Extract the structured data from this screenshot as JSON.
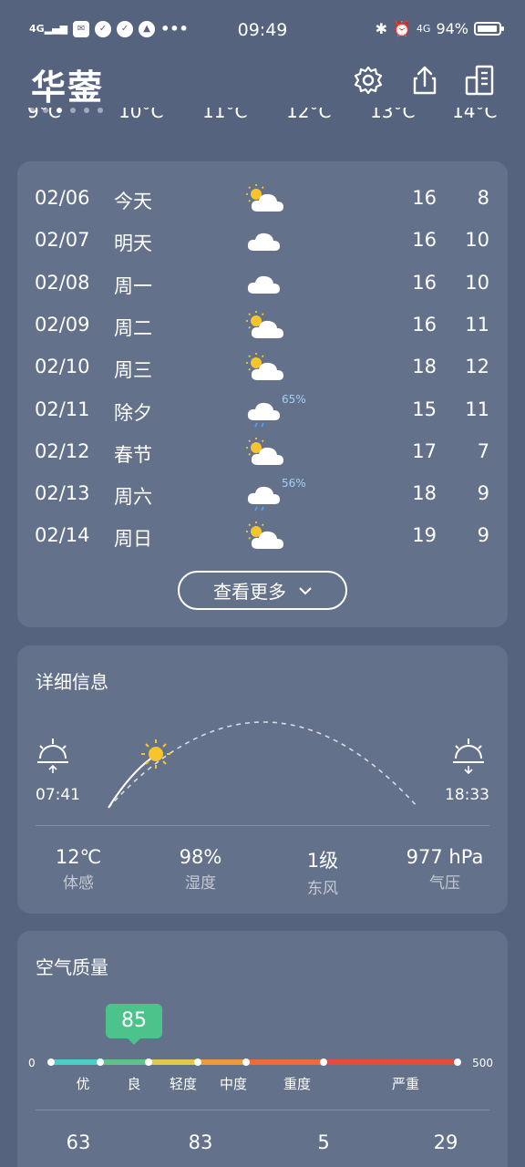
{
  "status_bar": {
    "network_left": "4G",
    "time": "09:49",
    "network_right": "4G",
    "battery_text": "94%",
    "battery_level": 0.94
  },
  "header": {
    "city": "华蓥",
    "page_count": 6,
    "active_page": 3,
    "hourly_peek": [
      "9°C",
      "10°C",
      "11°C",
      "12°C",
      "13°C",
      "14°C"
    ]
  },
  "forecast": {
    "rows": [
      {
        "date": "02/06",
        "day": "今天",
        "icon": "partly-cloudy-icon",
        "pop": "",
        "hi": "16",
        "lo": "8"
      },
      {
        "date": "02/07",
        "day": "明天",
        "icon": "cloudy-icon",
        "pop": "",
        "hi": "16",
        "lo": "10"
      },
      {
        "date": "02/08",
        "day": "周一",
        "icon": "cloudy-icon",
        "pop": "",
        "hi": "16",
        "lo": "10"
      },
      {
        "date": "02/09",
        "day": "周二",
        "icon": "partly-cloudy-icon",
        "pop": "",
        "hi": "16",
        "lo": "11"
      },
      {
        "date": "02/10",
        "day": "周三",
        "icon": "partly-cloudy-icon",
        "pop": "",
        "hi": "18",
        "lo": "12"
      },
      {
        "date": "02/11",
        "day": "除夕",
        "icon": "rain-icon",
        "pop": "65%",
        "hi": "15",
        "lo": "11"
      },
      {
        "date": "02/12",
        "day": "春节",
        "icon": "partly-cloudy-icon",
        "pop": "",
        "hi": "17",
        "lo": "7"
      },
      {
        "date": "02/13",
        "day": "周六",
        "icon": "rain-icon",
        "pop": "56%",
        "hi": "18",
        "lo": "9"
      },
      {
        "date": "02/14",
        "day": "周日",
        "icon": "partly-cloudy-icon",
        "pop": "",
        "hi": "19",
        "lo": "9"
      }
    ],
    "more_label": "查看更多"
  },
  "details": {
    "title": "详细信息",
    "sunrise": "07:41",
    "sunset": "18:33",
    "metrics": [
      {
        "value": "12℃",
        "label": "体感"
      },
      {
        "value": "98%",
        "label": "湿度"
      },
      {
        "value": "1级",
        "label": "东风"
      },
      {
        "value": "977 hPa",
        "label": "气压"
      }
    ]
  },
  "aqi": {
    "title": "空气质量",
    "value": "85",
    "min": "0",
    "max": "500",
    "levels": [
      "优",
      "良",
      "轻度",
      "中度",
      "重度",
      "严重"
    ],
    "colors": {
      "good": "#4ecdc4",
      "moderate": "#5cc487",
      "light": "#e4c64d",
      "medium": "#f0993c",
      "heavy": "#ee6a3a",
      "severe": "#e64a3b"
    },
    "pollutants": [
      "63",
      "83",
      "5",
      "29"
    ]
  }
}
